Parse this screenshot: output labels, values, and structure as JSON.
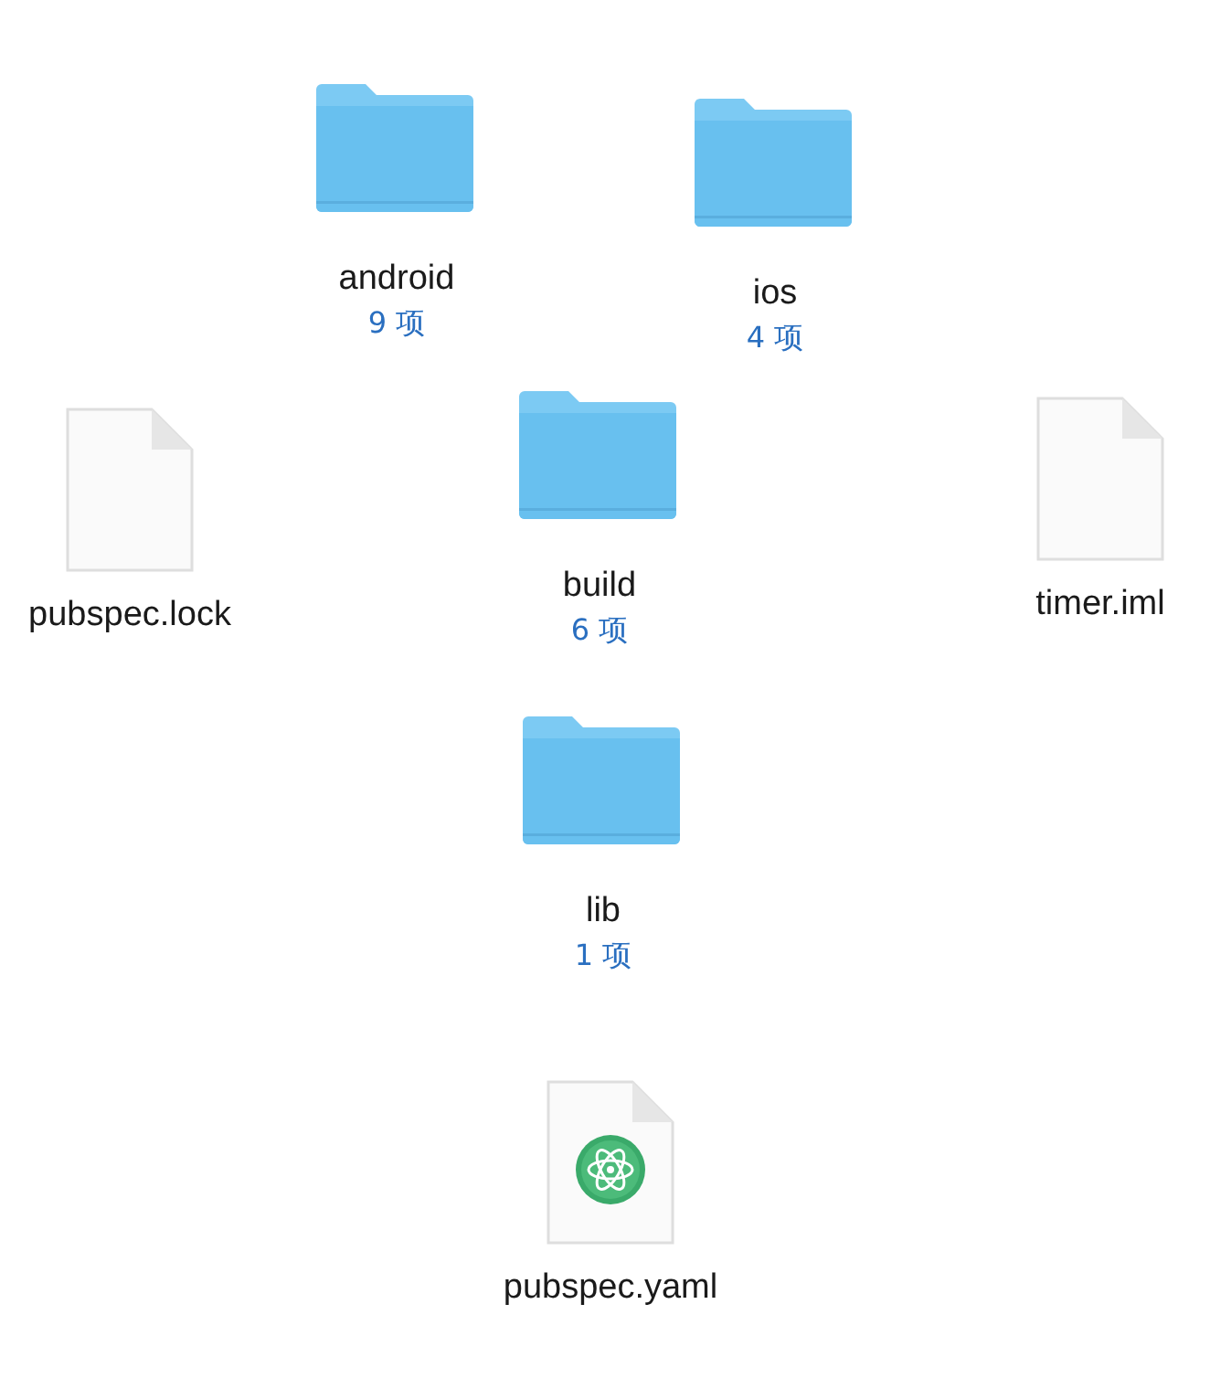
{
  "items": [
    {
      "kind": "folder",
      "name": "android",
      "count": "9 项"
    },
    {
      "kind": "folder",
      "name": "ios",
      "count": "4 项"
    },
    {
      "kind": "file",
      "name": "pubspec.lock"
    },
    {
      "kind": "folder",
      "name": "build",
      "count": "6 项"
    },
    {
      "kind": "file",
      "name": "timer.iml"
    },
    {
      "kind": "folder",
      "name": "lib",
      "count": "1 项"
    },
    {
      "kind": "atom-file",
      "name": "pubspec.yaml"
    }
  ]
}
